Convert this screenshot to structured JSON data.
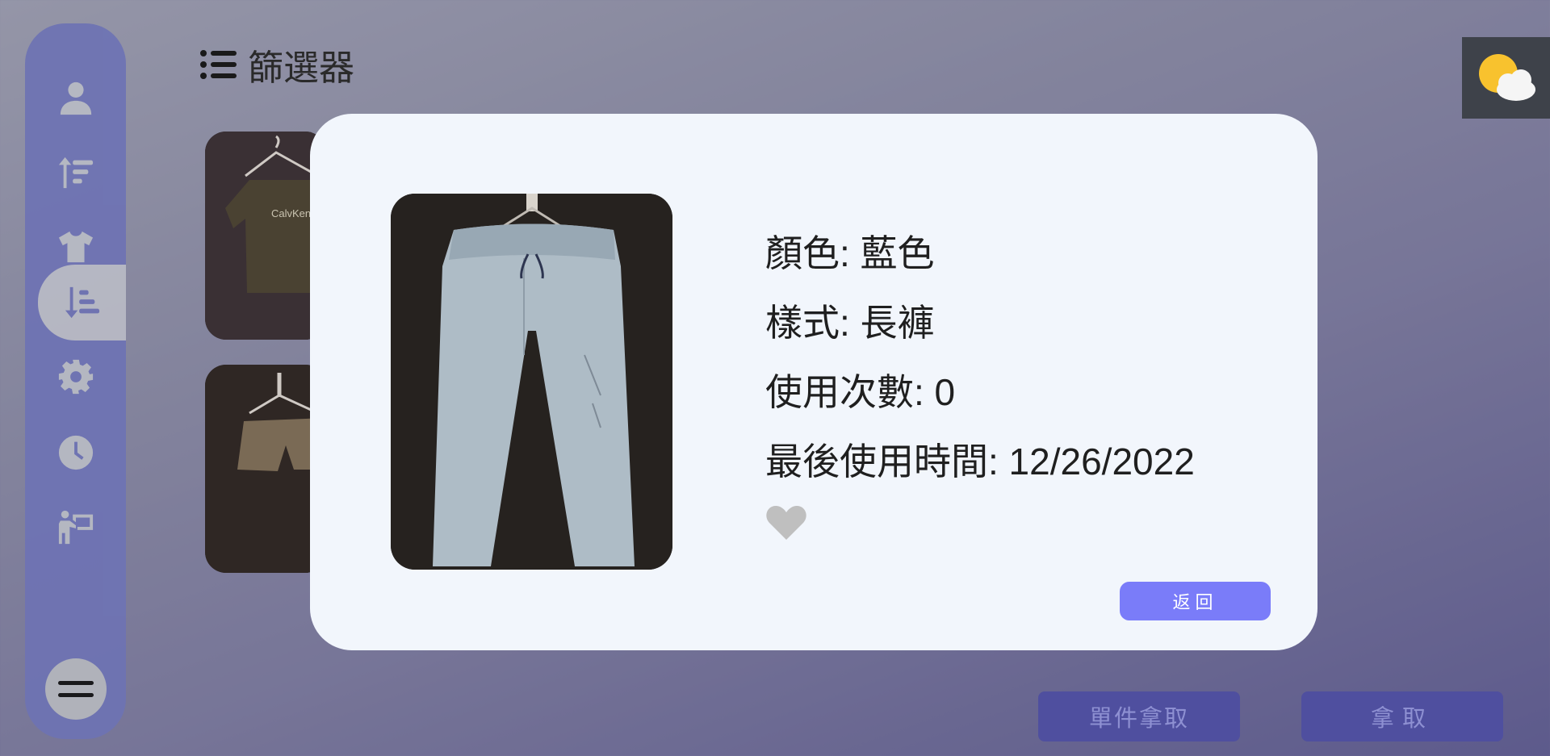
{
  "filter_header": {
    "title": "篩選器"
  },
  "sidebar": {
    "items": [
      {
        "icon": "user-icon"
      },
      {
        "icon": "sort-ascending-icon"
      },
      {
        "icon": "tshirt-icon"
      },
      {
        "icon": "sort-descending-icon",
        "active": true
      },
      {
        "icon": "gear-icon"
      },
      {
        "icon": "clock-icon"
      },
      {
        "icon": "take-item-icon"
      }
    ],
    "menu_icon": "menu-icon"
  },
  "cards": [
    {
      "description": "tshirt",
      "print_text": "CalvKenn"
    },
    {
      "description": "shorts"
    }
  ],
  "weather": {
    "icon": "partly-cloudy-icon"
  },
  "modal": {
    "color": "顏色: 藍色",
    "style": "樣式: 長褲",
    "usage": "使用次數: 0",
    "last_used": "最後使用時間: 12/26/2022",
    "return_label": "返回",
    "favorite_icon": "heart-icon"
  },
  "bottom_actions": {
    "single_take": "單件拿取",
    "take": "拿取"
  },
  "colors": {
    "sidebar": "#6e73b4",
    "modal_bg": "#f2f6fc",
    "return_button": "#7a7cf9",
    "bottom_button": "#4f4f9f"
  }
}
